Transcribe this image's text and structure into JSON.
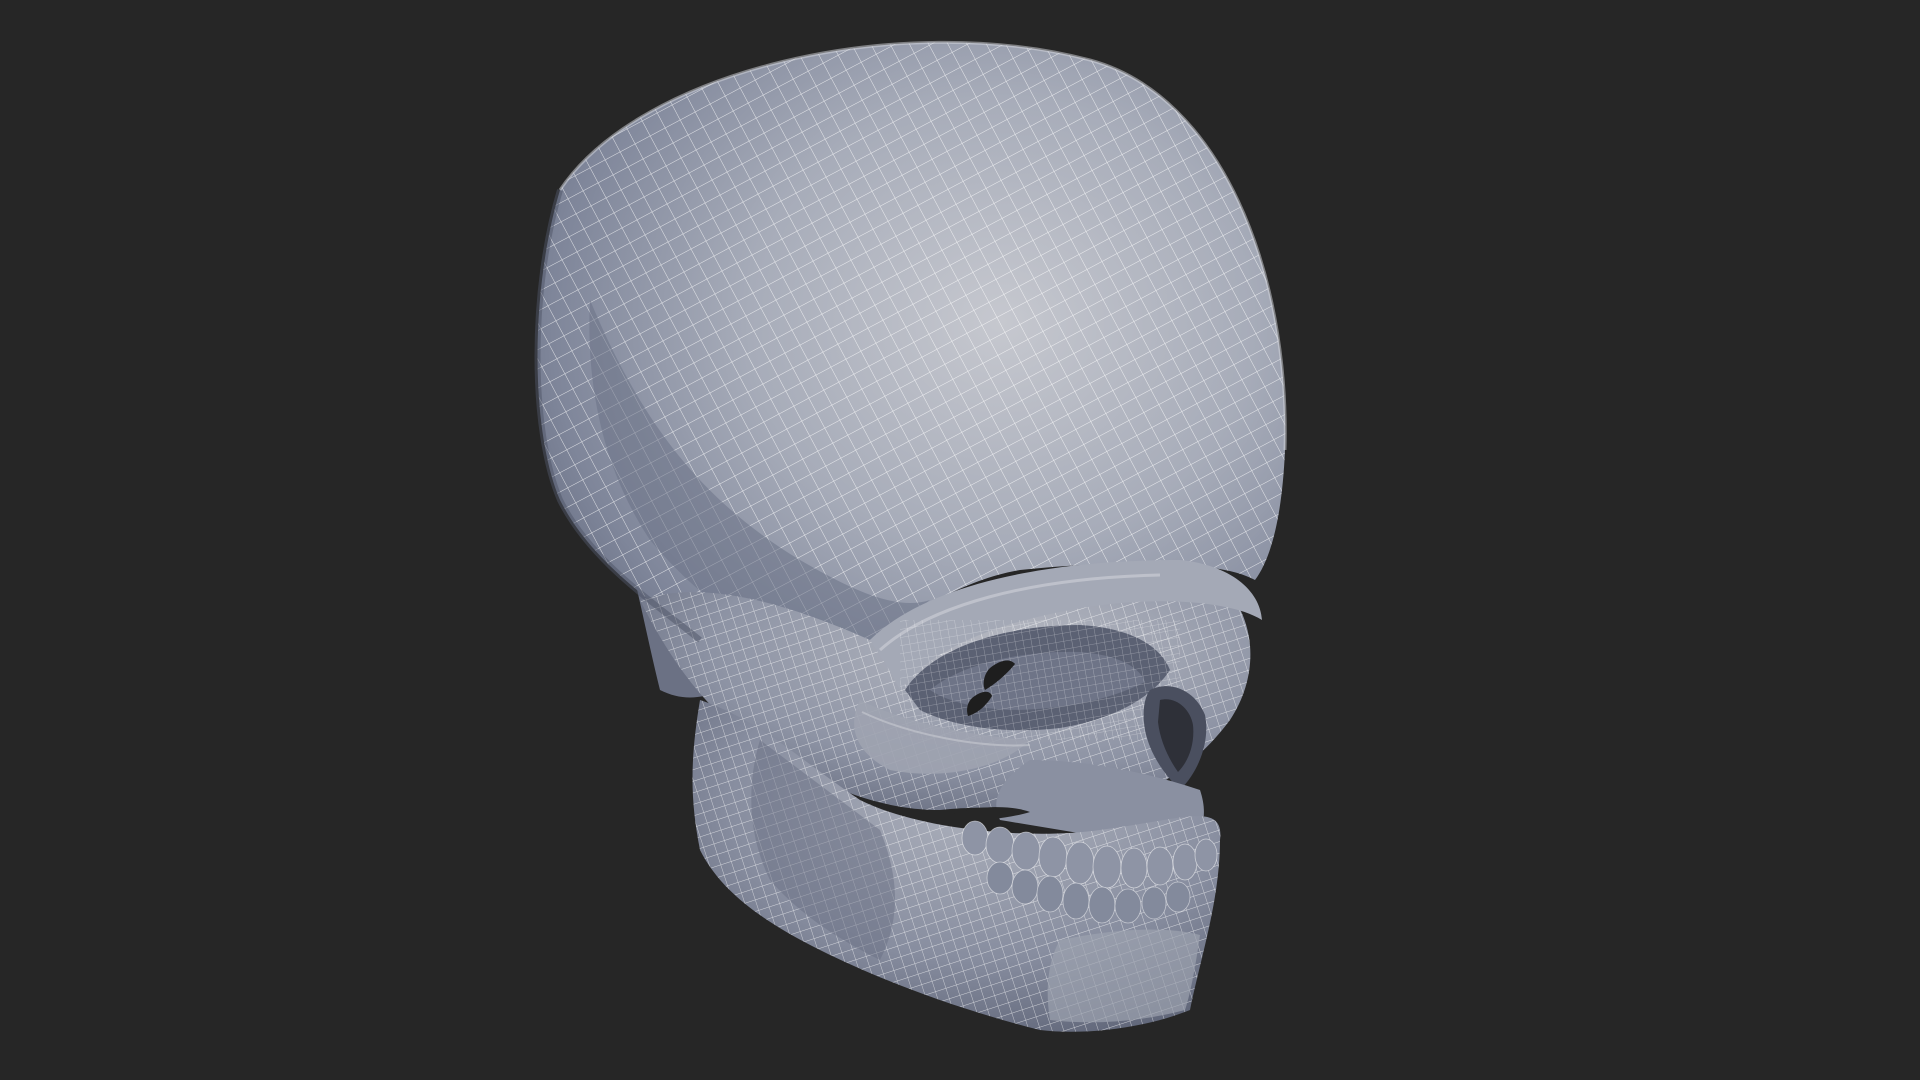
{
  "viewport": {
    "background_color": "#262626",
    "subject": "skull-wireframe-render"
  },
  "model": {
    "base_color": "#8f96a8",
    "highlight_color": "#c3c6cd",
    "shadow_color": "#5a6073",
    "wire_color": "#ffffff"
  }
}
